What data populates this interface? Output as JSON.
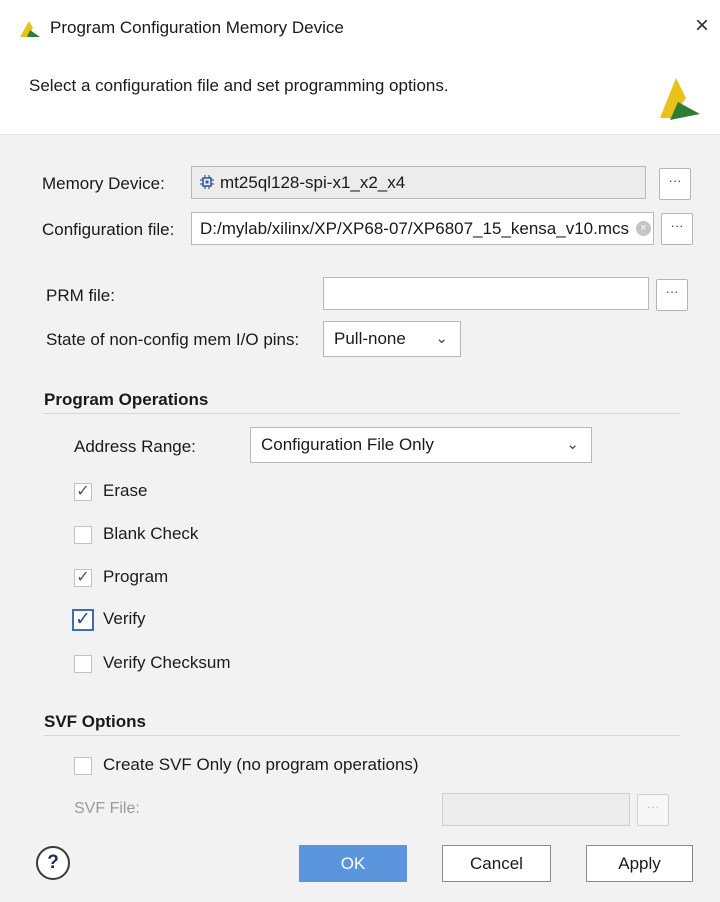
{
  "window": {
    "title": "Program Configuration Memory Device",
    "close_glyph": "×",
    "subtitle": "Select a configuration file and set programming options."
  },
  "memory_device": {
    "label": "Memory Device:",
    "value": "mt25ql128-spi-x1_x2_x4",
    "browse": "···"
  },
  "config_file": {
    "label": "Configuration file:",
    "value": "D:/mylab/xilinx/XP/XP68-07/XP6807_15_kensa_v10.mcs",
    "browse": "···",
    "clear_glyph": "×"
  },
  "prm_file": {
    "label": "PRM file:",
    "value": "",
    "browse": "···"
  },
  "state_pins": {
    "label": "State of non-config mem I/O pins:",
    "value": "Pull-none"
  },
  "program_operations": {
    "title": "Program Operations",
    "address_range": {
      "label": "Address Range:",
      "value": "Configuration File Only"
    },
    "checkboxes": [
      {
        "label": "Erase",
        "checked": true
      },
      {
        "label": "Blank Check",
        "checked": false
      },
      {
        "label": "Program",
        "checked": true
      },
      {
        "label": "Verify",
        "checked": true,
        "focused": true
      },
      {
        "label": "Verify Checksum",
        "checked": false
      }
    ]
  },
  "svf_options": {
    "title": "SVF Options",
    "create_svf": {
      "label": "Create SVF Only (no program operations)",
      "checked": false
    },
    "svf_file": {
      "label": "SVF File:",
      "value": "",
      "browse": "···"
    }
  },
  "buttons": {
    "help": "?",
    "ok": "OK",
    "cancel": "Cancel",
    "apply": "Apply"
  },
  "icons": {
    "check_glyph": "✓",
    "chevron_glyph": "⌄"
  },
  "colors": {
    "accent": "#5b96dc",
    "logo_yellow": "#e8c21a",
    "logo_green": "#2e7d32"
  }
}
